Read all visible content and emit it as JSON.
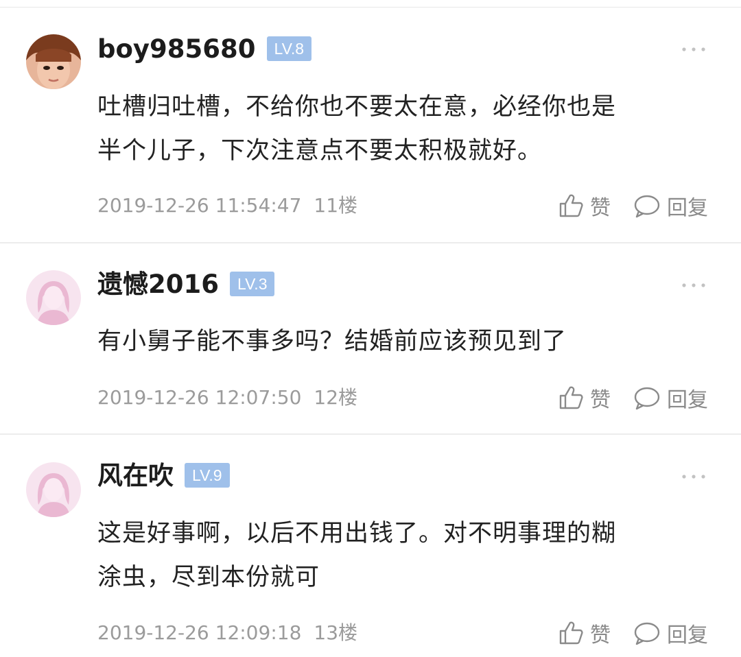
{
  "comments": [
    {
      "username": "boy985680",
      "level": "LV.8",
      "text_lines": [
        "吐槽归吐槽，不给你也不要太在意，必经你也是",
        "半个儿子，下次注意点不要太积极就好。"
      ],
      "timestamp": "2019-12-26 11:54:47",
      "floor": "11楼",
      "like_label": "赞",
      "reply_label": "回复",
      "avatar": "photo-avatar"
    },
    {
      "username": "遗憾2016",
      "level": "LV.3",
      "text_lines": [
        "有小舅子能不事多吗？结婚前应该预见到了"
      ],
      "timestamp": "2019-12-26 12:07:50",
      "floor": "12楼",
      "like_label": "赞",
      "reply_label": "回复",
      "avatar": "default-female-avatar"
    },
    {
      "username": "风在吹",
      "level": "LV.9",
      "text_lines": [
        "这是好事啊，以后不用出钱了。对不明事理的糊",
        "涂虫，尽到本份就可"
      ],
      "timestamp": "2019-12-26 12:09:18",
      "floor": "13楼",
      "like_label": "赞",
      "reply_label": "回复",
      "avatar": "default-female-avatar"
    }
  ],
  "icons": {
    "more": "more-dots-icon",
    "like": "thumbs-up-icon",
    "reply": "speech-bubble-icon"
  },
  "colors": {
    "level_badge": "#9fc0ea",
    "meta_text": "#9b9b9b",
    "divider": "#ececec"
  }
}
